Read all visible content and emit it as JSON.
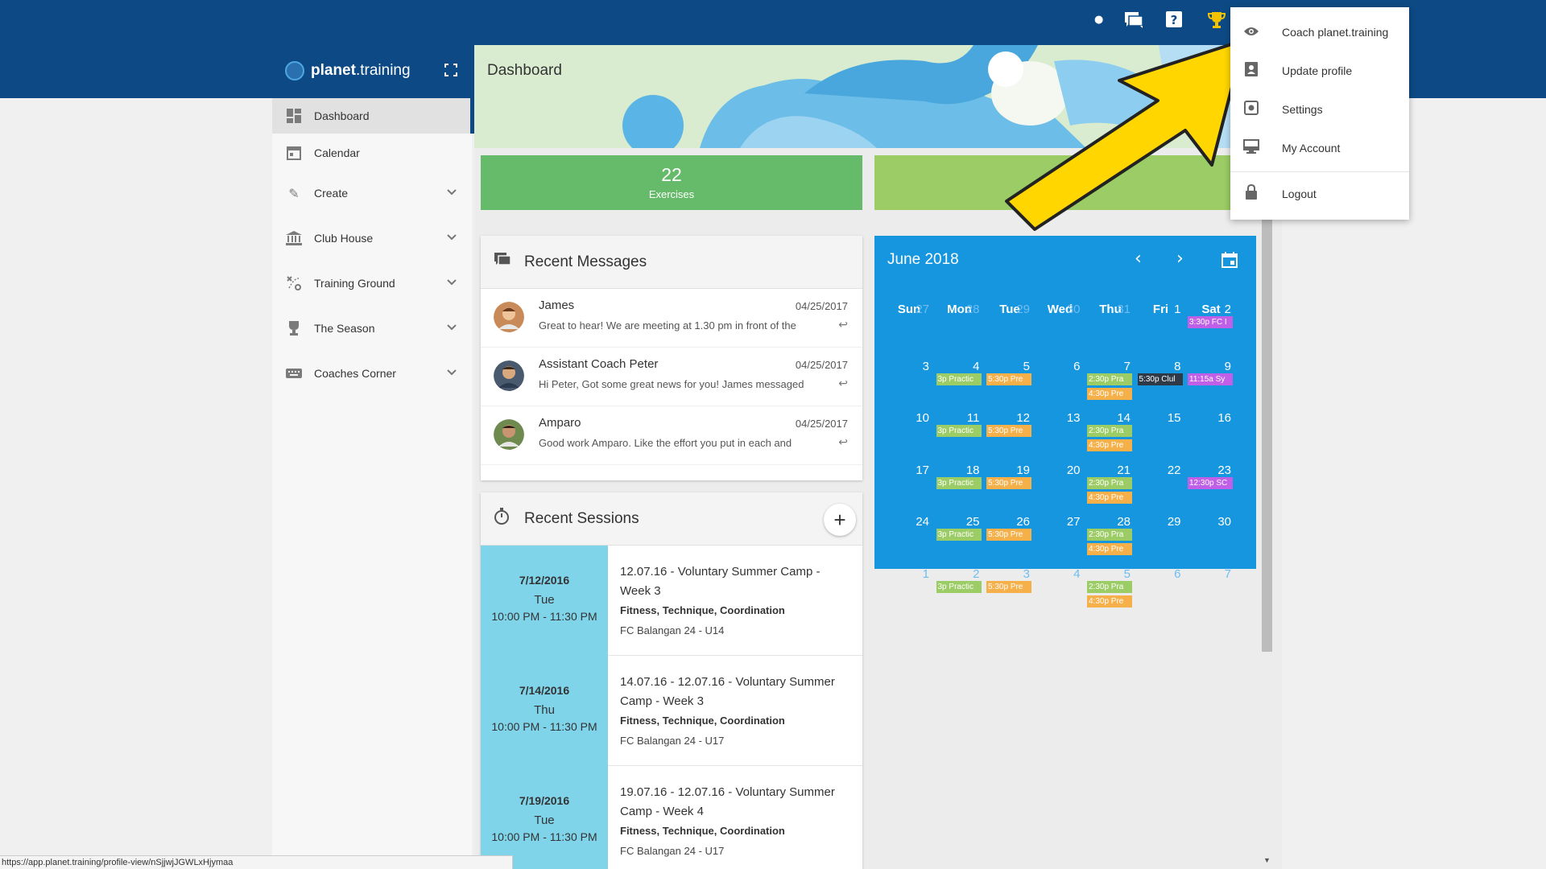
{
  "app": {
    "brand_bold": "planet",
    "brand_rest": ".training"
  },
  "page": {
    "title": "Dashboard"
  },
  "sidebar": {
    "items": [
      {
        "label": "Dashboard",
        "icon": "dashboard-icon",
        "active": true
      },
      {
        "label": "Calendar",
        "icon": "calendar-icon"
      },
      {
        "label": "Create",
        "icon": "pencil-icon",
        "expandable": true
      },
      {
        "label": "Club House",
        "icon": "building-icon",
        "expandable": true
      },
      {
        "label": "Training Ground",
        "icon": "tactics-icon",
        "expandable": true
      },
      {
        "label": "The Season",
        "icon": "trophy-icon",
        "expandable": true
      },
      {
        "label": "Coaches Corner",
        "icon": "keyboard-icon",
        "expandable": true
      }
    ]
  },
  "stats": [
    {
      "value": "22",
      "label": "Exercises",
      "color": "#66bb6a"
    },
    {
      "value": "",
      "label": "Sessions",
      "color": "#9ccc65"
    }
  ],
  "messages": {
    "title": "Recent Messages",
    "items": [
      {
        "name": "James",
        "date": "04/25/2017",
        "text": "Great to hear! We are meeting at 1.30 pm in front of the"
      },
      {
        "name": "Assistant Coach Peter",
        "date": "04/25/2017",
        "text": "Hi Peter, Got some great news for you! James messaged"
      },
      {
        "name": "Amparo",
        "date": "04/25/2017",
        "text": "Good work Amparo. Like the effort you put in each and"
      }
    ]
  },
  "sessions": {
    "title": "Recent Sessions",
    "add_label": "+",
    "items": [
      {
        "date": "7/12/2016",
        "weekday": "Tue",
        "time": "10:00 PM - 11:30 PM",
        "title": "12.07.16 - Voluntary Summer Camp - Week 3",
        "tags": "Fitness, Technique, Coordination",
        "team": "FC Balangan 24 - U14"
      },
      {
        "date": "7/14/2016",
        "weekday": "Thu",
        "time": "10:00 PM - 11:30 PM",
        "title": "14.07.16 - 12.07.16 - Voluntary Summer Camp - Week 3",
        "tags": "Fitness, Technique, Coordination",
        "team": "FC Balangan 24 - U17"
      },
      {
        "date": "7/19/2016",
        "weekday": "Tue",
        "time": "10:00 PM - 11:30 PM",
        "title": "19.07.16 - 12.07.16 - Voluntary Summer Camp - Week 4",
        "tags": "Fitness, Technique, Coordination",
        "team": "FC Balangan 24 - U17"
      }
    ]
  },
  "calendar": {
    "title": "June 2018",
    "weekdays": [
      "Sun",
      "Mon",
      "Tue",
      "Wed",
      "Thu",
      "Fri",
      "Sat"
    ],
    "weeks": [
      [
        {
          "day": "27",
          "muted": true,
          "events": []
        },
        {
          "day": "28",
          "muted": true,
          "events": []
        },
        {
          "day": "29",
          "muted": true,
          "events": []
        },
        {
          "day": "30",
          "muted": true,
          "events": []
        },
        {
          "day": "31",
          "muted": true,
          "events": []
        },
        {
          "day": "1",
          "events": []
        },
        {
          "day": "2",
          "events": [
            {
              "text": "3:30p FC I",
              "color": "purple"
            }
          ]
        }
      ],
      [
        {
          "day": "3",
          "events": []
        },
        {
          "day": "4",
          "events": [
            {
              "text": "3p Practic",
              "color": "green"
            }
          ]
        },
        {
          "day": "5",
          "events": [
            {
              "text": "5:30p Pre",
              "color": "orange"
            }
          ]
        },
        {
          "day": "6",
          "events": []
        },
        {
          "day": "7",
          "events": [
            {
              "text": "2:30p Pra",
              "color": "green"
            },
            {
              "text": "4:30p Pre",
              "color": "orange"
            }
          ]
        },
        {
          "day": "8",
          "events": [
            {
              "text": "5:30p Clul",
              "color": "dark"
            }
          ]
        },
        {
          "day": "9",
          "events": [
            {
              "text": "11:15a Sy",
              "color": "purple"
            }
          ]
        }
      ],
      [
        {
          "day": "10",
          "events": []
        },
        {
          "day": "11",
          "events": [
            {
              "text": "3p Practic",
              "color": "green"
            }
          ]
        },
        {
          "day": "12",
          "events": [
            {
              "text": "5:30p Pre",
              "color": "orange"
            }
          ]
        },
        {
          "day": "13",
          "events": []
        },
        {
          "day": "14",
          "events": [
            {
              "text": "2:30p Pra",
              "color": "green"
            },
            {
              "text": "4:30p Pre",
              "color": "orange"
            }
          ]
        },
        {
          "day": "15",
          "events": []
        },
        {
          "day": "16",
          "events": []
        }
      ],
      [
        {
          "day": "17",
          "events": []
        },
        {
          "day": "18",
          "events": [
            {
              "text": "3p Practic",
              "color": "green"
            }
          ]
        },
        {
          "day": "19",
          "events": [
            {
              "text": "5:30p Pre",
              "color": "orange"
            }
          ]
        },
        {
          "day": "20",
          "events": []
        },
        {
          "day": "21",
          "events": [
            {
              "text": "2:30p Pra",
              "color": "green"
            },
            {
              "text": "4:30p Pre",
              "color": "orange"
            }
          ]
        },
        {
          "day": "22",
          "events": []
        },
        {
          "day": "23",
          "events": [
            {
              "text": "12:30p SC",
              "color": "purple"
            }
          ]
        }
      ],
      [
        {
          "day": "24",
          "events": []
        },
        {
          "day": "25",
          "events": [
            {
              "text": "3p Practic",
              "color": "green"
            }
          ]
        },
        {
          "day": "26",
          "events": [
            {
              "text": "5:30p Pre",
              "color": "orange"
            }
          ]
        },
        {
          "day": "27",
          "events": []
        },
        {
          "day": "28",
          "events": [
            {
              "text": "2:30p Pra",
              "color": "green"
            },
            {
              "text": "4:30p Pre",
              "color": "orange"
            }
          ]
        },
        {
          "day": "29",
          "events": []
        },
        {
          "day": "30",
          "events": []
        }
      ],
      [
        {
          "day": "1",
          "muted": true,
          "events": []
        },
        {
          "day": "2",
          "muted": true,
          "events": [
            {
              "text": "3p Practic",
              "color": "green"
            }
          ]
        },
        {
          "day": "3",
          "muted": true,
          "events": [
            {
              "text": "5:30p Pre",
              "color": "orange"
            }
          ]
        },
        {
          "day": "4",
          "muted": true,
          "events": []
        },
        {
          "day": "5",
          "muted": true,
          "events": [
            {
              "text": "2:30p Pra",
              "color": "green"
            },
            {
              "text": "4:30p Pre",
              "color": "orange"
            }
          ]
        },
        {
          "day": "6",
          "muted": true,
          "events": []
        },
        {
          "day": "7",
          "muted": true,
          "events": []
        }
      ]
    ]
  },
  "user_menu": {
    "items": [
      {
        "label": "Coach planet.training",
        "icon": "eye-icon"
      },
      {
        "label": "Update profile",
        "icon": "profile-icon"
      },
      {
        "label": "Settings",
        "icon": "settings-icon"
      },
      {
        "label": "My Account",
        "icon": "monitor-icon"
      },
      {
        "label": "Logout",
        "icon": "lock-icon"
      }
    ]
  },
  "status_url": "https://app.planet.training/profile-view/nSjjwjJGWLxHjymaa",
  "colors": {
    "header": "#0d4a85",
    "calendar": "#1796e0",
    "session_date": "#7fd4ea",
    "arrow": "#ffd600"
  }
}
